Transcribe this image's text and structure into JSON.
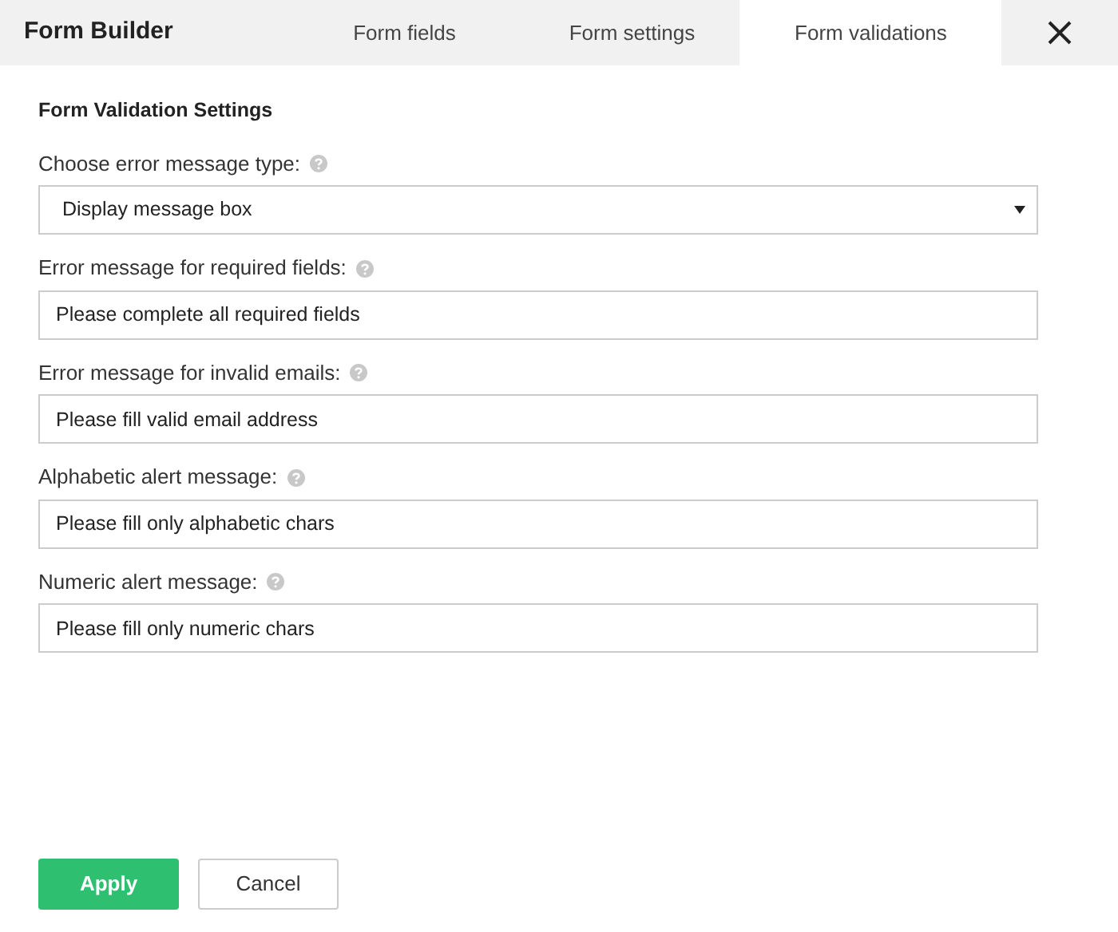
{
  "window": {
    "title": "Form Builder"
  },
  "tabs": [
    {
      "label": "Form fields",
      "selected": false
    },
    {
      "label": "Form settings",
      "selected": false
    },
    {
      "label": "Form validations",
      "selected": true
    }
  ],
  "section_title": "Form Validation Settings",
  "fields": [
    {
      "kind": "dropdown",
      "label": "Choose error message type:",
      "value": "Display message box"
    },
    {
      "kind": "text",
      "label": "Error message for required fields:",
      "value": "Please complete all required fields"
    },
    {
      "kind": "text",
      "label": "Error message for invalid emails:",
      "value": "Please fill valid email address"
    },
    {
      "kind": "text",
      "label": "Alphabetic alert message:",
      "value": "Please fill only alphabetic chars"
    },
    {
      "kind": "text",
      "label": "Numeric alert message:",
      "value": "Please fill only numeric chars"
    }
  ],
  "buttons": [
    {
      "kind": "primary",
      "label": "Apply"
    },
    {
      "kind": "secondary",
      "label": "Cancel"
    }
  ]
}
